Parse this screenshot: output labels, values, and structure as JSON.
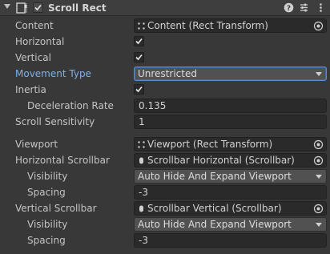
{
  "component": {
    "title": "Scroll Rect",
    "icon": "scroll-rect-icon",
    "enabled": true,
    "header_icons": [
      "help-icon",
      "preset-icon",
      "context-menu-icon"
    ]
  },
  "fields": {
    "content": {
      "label": "Content",
      "value": "Content (Rect Transform)",
      "icon": "rect-transform-icon"
    },
    "horizontal": {
      "label": "Horizontal",
      "checked": true
    },
    "vertical": {
      "label": "Vertical",
      "checked": true
    },
    "movement_type": {
      "label": "Movement Type",
      "value": "Unrestricted"
    },
    "inertia": {
      "label": "Inertia",
      "checked": true
    },
    "deceleration_rate": {
      "label": "Deceleration Rate",
      "value": "0.135"
    },
    "scroll_sensitivity": {
      "label": "Scroll Sensitivity",
      "value": "1"
    },
    "viewport": {
      "label": "Viewport",
      "value": "Viewport (Rect Transform)",
      "icon": "rect-transform-icon"
    },
    "horizontal_scrollbar": {
      "label": "Horizontal Scrollbar",
      "value": "Scrollbar Horizontal (Scrollbar)",
      "icon": "scrollbar-icon"
    },
    "h_visibility": {
      "label": "Visibility",
      "value": "Auto Hide And Expand Viewport"
    },
    "h_spacing": {
      "label": "Spacing",
      "value": "-3"
    },
    "vertical_scrollbar": {
      "label": "Vertical Scrollbar",
      "value": "Scrollbar Vertical (Scrollbar)",
      "icon": "scrollbar-icon"
    },
    "v_visibility": {
      "label": "Visibility",
      "value": "Auto Hide And Expand Viewport"
    },
    "v_spacing": {
      "label": "Spacing",
      "value": "-3"
    }
  }
}
